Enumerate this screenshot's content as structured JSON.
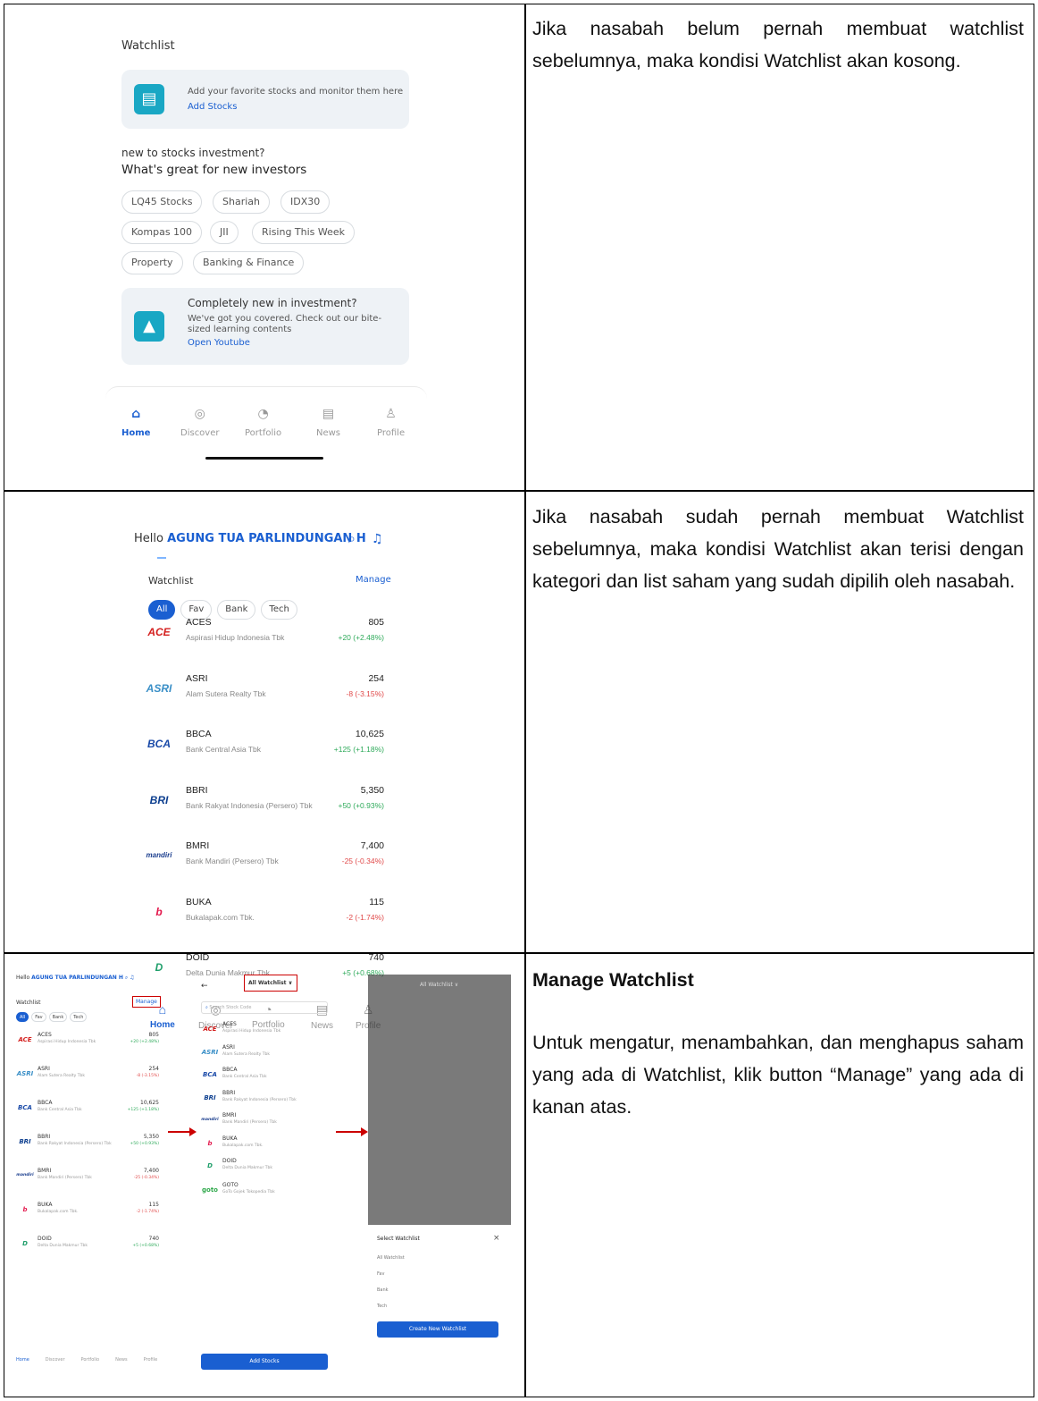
{
  "rows": [
    {
      "paragraphs": [
        "Jika nasabah belum pernah membuat watchlist sebelumnya, maka kondisi Watchlist akan kosong."
      ]
    },
    {
      "paragraphs": [
        "Jika nasabah sudah pernah membuat Watchlist sebelumnya, maka kondisi Watchlist akan terisi dengan kategori dan list saham yang sudah dipilih oleh nasabah."
      ]
    },
    {
      "title": "Manage Watchlist",
      "paragraphs": [
        "Untuk mengatur, menambahkan, dan menghapus saham yang ada di Watchlist, klik button “Manage” yang ada di kanan atas."
      ]
    }
  ],
  "empty_screen": {
    "watchlist_title": "Watchlist",
    "add_card_text": "Add your favorite stocks and monitor them here",
    "add_card_link": "Add Stocks",
    "new_to": "new to stocks investment?",
    "great_for": "What's great for new investors",
    "chips": [
      "LQ45 Stocks",
      "Shariah",
      "IDX30",
      "Kompas 100",
      "JII",
      "Rising This Week",
      "Property",
      "Banking & Finance"
    ],
    "learn_title": "Completely new in investment?",
    "learn_text_1": "We've got you covered. Check out our bite-",
    "learn_text_2": "sized learning contents",
    "learn_link": "Open Youtube"
  },
  "nav": [
    "Home",
    "Discover",
    "Portfolio",
    "News",
    "Profile"
  ],
  "filled_screen": {
    "hello_prefix": "Hello",
    "user_name": "AGUNG TUA PARLINDUNGAN H",
    "watchlist_title": "Watchlist",
    "manage_label": "Manage",
    "tabs": [
      "All",
      "Fav",
      "Bank",
      "Tech"
    ]
  },
  "stocks": [
    {
      "logo": "ACE",
      "code": "ACES",
      "name": "Aspirasi Hidup Indonesia Tbk",
      "price": "805",
      "change": "+20 (+2.48%)",
      "up": true,
      "color": "#d4201f"
    },
    {
      "logo": "ASRI",
      "code": "ASRI",
      "name": "Alam Sutera Realty Tbk",
      "price": "254",
      "change": "-8 (-3.15%)",
      "up": false,
      "color": "#3a8fc7"
    },
    {
      "logo": "BCA",
      "code": "BBCA",
      "name": "Bank Central Asia Tbk",
      "price": "10,625",
      "change": "+125 (+1.18%)",
      "up": true,
      "color": "#1a4aa8"
    },
    {
      "logo": "BRI",
      "code": "BBRI",
      "name": "Bank Rakyat Indonesia (Persero) Tbk",
      "price": "5,350",
      "change": "+50 (+0.93%)",
      "up": true,
      "color": "#0d3f8f"
    },
    {
      "logo": "mandiri",
      "code": "BMRI",
      "name": "Bank Mandiri (Persero) Tbk",
      "price": "7,400",
      "change": "-25 (-0.34%)",
      "up": false,
      "color": "#1b3e8e"
    },
    {
      "logo": "b",
      "code": "BUKA",
      "name": "Bukalapak.com Tbk.",
      "price": "115",
      "change": "-2 (-1.74%)",
      "up": false,
      "color": "#e3194d"
    },
    {
      "logo": "D",
      "code": "DOID",
      "name": "Delta Dunia Makmur Tbk",
      "price": "740",
      "change": "+5 (+0.68%)",
      "up": true,
      "color": "#1e9e6a"
    }
  ],
  "manage_screen": {
    "dropdown_label": "All Watchlist ∨",
    "search_placeholder": "Search Stock Code",
    "add_button": "Add Stocks",
    "extra_stock_code": "GOTO",
    "extra_stock_name": "GoTo Gojek Tokopedia Tbk",
    "sheet_title": "Select Watchlist",
    "sheet_close": "×",
    "sheet_options": [
      "All Watchlist",
      "Fav",
      "Bank",
      "Tech"
    ],
    "create_button": "Create New Watchlist"
  },
  "colors": {
    "accent": "#1a5fd1",
    "up": "#2eaa5a",
    "down": "#e04848",
    "icon_teal": "#19a7c4"
  }
}
